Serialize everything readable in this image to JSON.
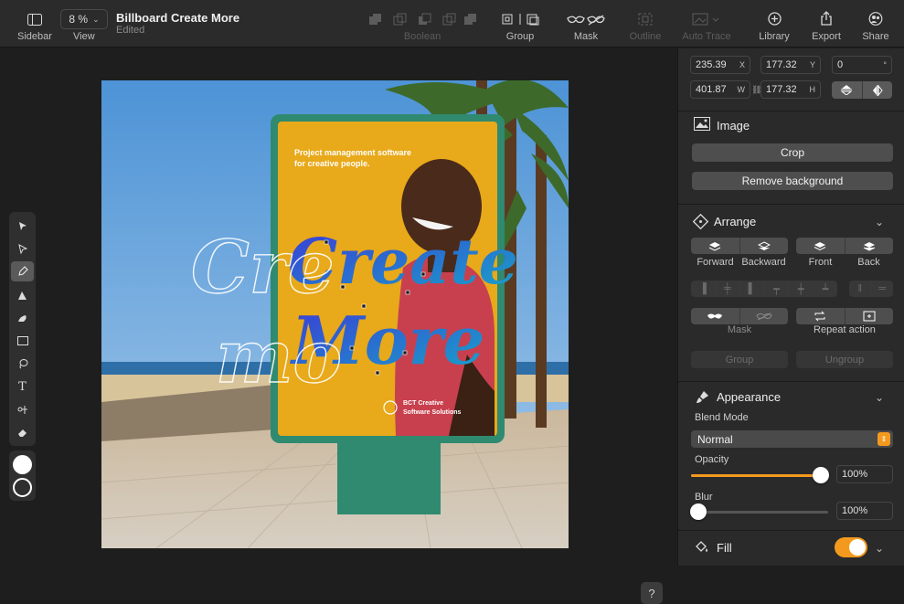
{
  "toolbar": {
    "sidebar_label": "Sidebar",
    "zoom_value": "8 %",
    "view_label": "View",
    "title": "Billboard Create More",
    "status": "Edited",
    "boolean_label": "Boolean",
    "group_label": "Group",
    "mask_label": "Mask",
    "outline_label": "Outline",
    "autotrace_label": "Auto Trace",
    "library_label": "Library",
    "export_label": "Export",
    "share_label": "Share"
  },
  "canvas": {
    "billboard_headline": "Project management software for creative people.",
    "lettering_create": "Create",
    "lettering_more": "More",
    "company_line1": "BCT Creative",
    "company_line2": "Software Solutions",
    "help": "?"
  },
  "geometry_fields": {
    "x": "235.39",
    "x_unit": "X",
    "y": "177.32",
    "y_unit": "Y",
    "rotation": "0",
    "rotation_unit": "°",
    "w": "401.87",
    "w_unit": "W",
    "h": "177.32",
    "h_unit": "H"
  },
  "image_section": {
    "title": "Image",
    "crop_label": "Crop",
    "remove_bg_label": "Remove background"
  },
  "arrange_section": {
    "title": "Arrange",
    "forward": "Forward",
    "backward": "Backward",
    "front": "Front",
    "back": "Back",
    "mask": "Mask",
    "repeat_action": "Repeat action",
    "group": "Group",
    "ungroup": "Ungroup"
  },
  "appearance_section": {
    "title": "Appearance",
    "blend_mode_label": "Blend Mode",
    "blend_mode_value": "Normal",
    "opacity_label": "Opacity",
    "opacity_value": "100%",
    "opacity_level": 1.0,
    "blur_label": "Blur",
    "blur_value": "100%",
    "blur_level": 0.0
  },
  "fill_section": {
    "title": "Fill",
    "enabled": true
  },
  "colors": {
    "accent": "#f39a1e",
    "billboard_yellow": "#e8a91a",
    "billboard_frame": "#2f8a70"
  }
}
